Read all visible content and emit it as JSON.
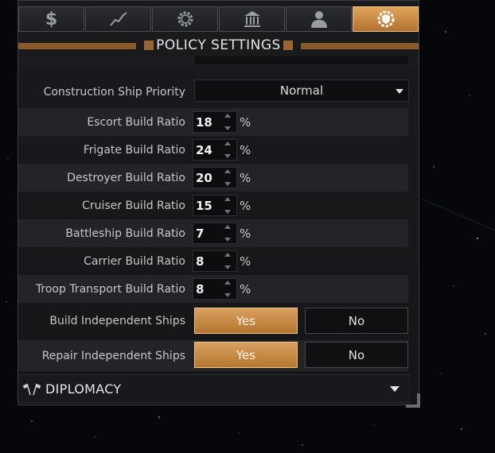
{
  "tabs": [
    {
      "icon": "dollar-icon",
      "active": false
    },
    {
      "icon": "chart-line-icon",
      "active": false
    },
    {
      "icon": "gear-dollar-icon",
      "active": false
    },
    {
      "icon": "government-building-icon",
      "active": false
    },
    {
      "icon": "person-icon",
      "active": false
    },
    {
      "icon": "shield-gear-icon",
      "active": true
    }
  ],
  "header": {
    "title": "POLICY SETTINGS"
  },
  "construction": {
    "label": "Construction Ship Priority",
    "value": "Normal"
  },
  "ratios": [
    {
      "label": "Escort Build Ratio",
      "value": "18",
      "unit": "%"
    },
    {
      "label": "Frigate Build Ratio",
      "value": "24",
      "unit": "%"
    },
    {
      "label": "Destroyer Build Ratio",
      "value": "20",
      "unit": "%"
    },
    {
      "label": "Cruiser Build Ratio",
      "value": "15",
      "unit": "%"
    },
    {
      "label": "Battleship Build Ratio",
      "value": "7",
      "unit": "%"
    },
    {
      "label": "Carrier Build Ratio",
      "value": "8",
      "unit": "%"
    },
    {
      "label": "Troop Transport Build Ratio",
      "value": "8",
      "unit": "%"
    }
  ],
  "build_independent": {
    "label": "Build Independent Ships",
    "yes": "Yes",
    "no": "No",
    "selected": "Yes"
  },
  "repair_independent": {
    "label": "Repair Independent Ships",
    "yes": "Yes",
    "no": "No",
    "selected": "Yes"
  },
  "diplomacy": {
    "title": "DIPLOMACY",
    "icon": "flags-icon"
  },
  "colors": {
    "accent": "#c98a45",
    "panel": "#181a1d",
    "background": "#05070b"
  }
}
